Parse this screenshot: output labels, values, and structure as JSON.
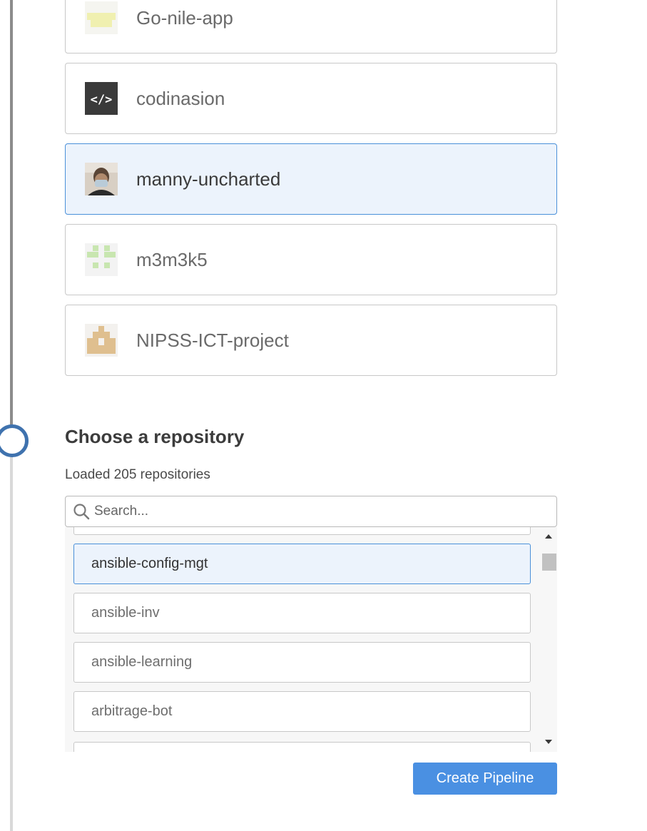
{
  "organizations": [
    {
      "label": "Go-nile-app",
      "icon": "identicon-yellow-icon",
      "selected": false
    },
    {
      "label": "codinasion",
      "icon": "code-brackets-icon",
      "selected": false
    },
    {
      "label": "manny-uncharted",
      "icon": "user-photo-avatar",
      "selected": true
    },
    {
      "label": "m3m3k5",
      "icon": "identicon-green-icon",
      "selected": false
    },
    {
      "label": "NIPSS-ICT-project",
      "icon": "identicon-tan-icon",
      "selected": false
    }
  ],
  "repository_section": {
    "title": "Choose a repository",
    "loaded_text": "Loaded 205 repositories"
  },
  "search": {
    "placeholder": "Search...",
    "value": ""
  },
  "repositories": [
    {
      "label": "ansible-config-mgt",
      "selected": true
    },
    {
      "label": "ansible-inv",
      "selected": false
    },
    {
      "label": "ansible-learning",
      "selected": false
    },
    {
      "label": "arbitrage-bot",
      "selected": false
    }
  ],
  "create_button": {
    "label": "Create Pipeline"
  },
  "colors": {
    "accent": "#4a90e2",
    "selected_bg": "#ecf3fc",
    "step_circle": "#3f72ae"
  }
}
